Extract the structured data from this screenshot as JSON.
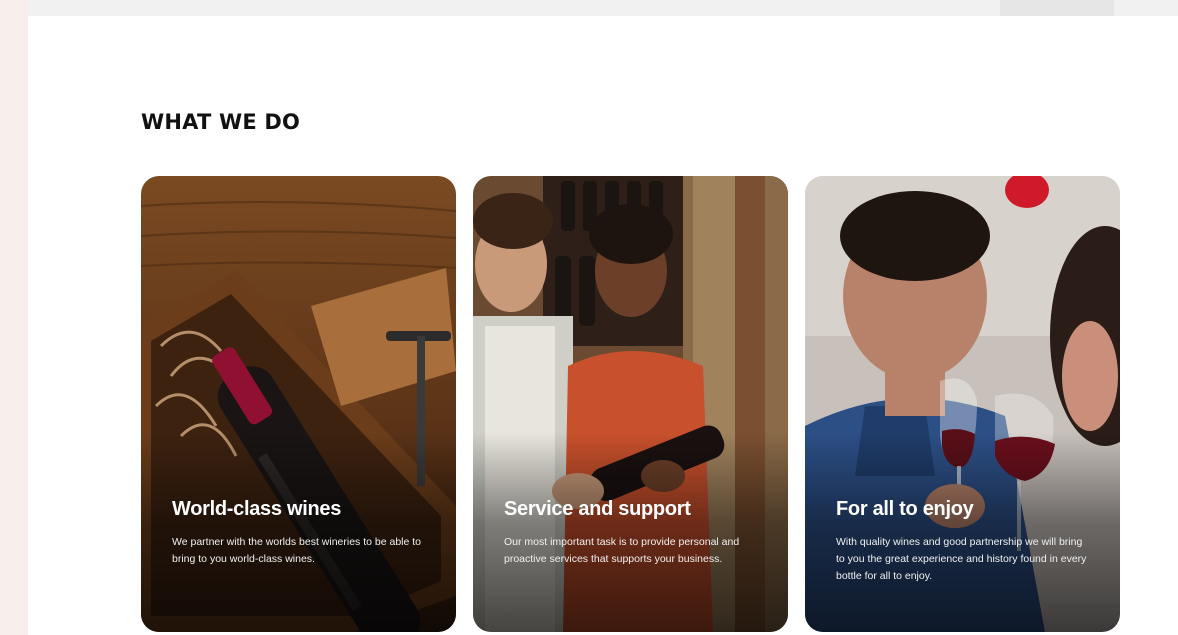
{
  "section": {
    "title": "WHAT WE DO"
  },
  "cards": [
    {
      "title": "World-class wines",
      "text": "We partner with the worlds best wineries to be able to bring to you world-class wines."
    },
    {
      "title": "Service and support",
      "text": "Our most important task is to provide personal and proactive services that supports your business."
    },
    {
      "title": "For all to enjoy",
      "text": "With quality wines and good partnership we will bring to you the great experience and history  found in every bottle for all to enjoy."
    }
  ],
  "colors": {
    "title_text": "#111111",
    "card_text": "#ffffff",
    "wine_red": "#8f1030"
  }
}
